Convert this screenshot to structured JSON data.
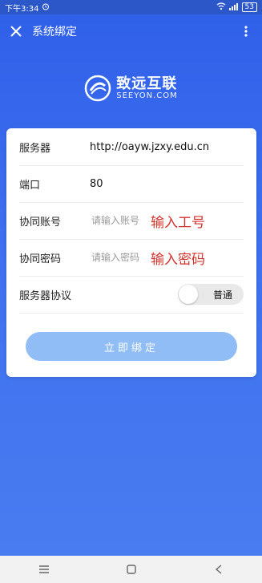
{
  "status": {
    "time": "下午3:34",
    "alarm_icon": "alarm-icon",
    "battery": "53"
  },
  "topbar": {
    "title": "系统绑定"
  },
  "logo": {
    "cn": "致远互联",
    "en": "SEEYON.COM"
  },
  "form": {
    "server_label": "服务器",
    "server_value": "http://oayw.jzxy.edu.cn",
    "port_label": "端口",
    "port_value": "80",
    "account_label": "协同账号",
    "account_placeholder": "请输入账号",
    "account_hint": "输入工号",
    "password_label": "协同密码",
    "password_placeholder": "请输入密码",
    "password_hint": "输入密码",
    "protocol_label": "服务器协议",
    "protocol_value": "普通",
    "bind_button": "立即绑定"
  }
}
